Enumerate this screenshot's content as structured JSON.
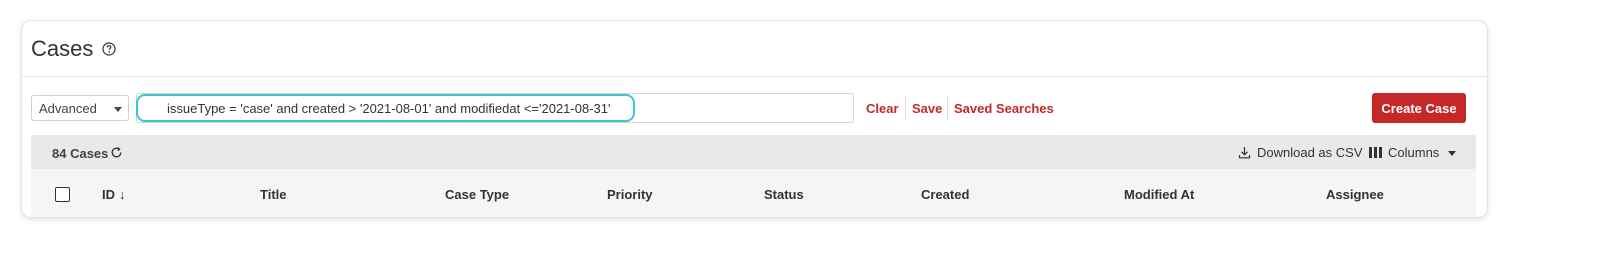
{
  "page": {
    "title": "Cases",
    "help_icon": "question-circle-icon"
  },
  "toolbar": {
    "mode": "Advanced",
    "query": "issueType = 'case' and created > '2021-08-01' and modifiedat <='2021-08-31'",
    "clear_label": "Clear",
    "save_label": "Save",
    "saved_searches_label": "Saved Searches",
    "create_label": "Create Case",
    "accent_color": "#c62828",
    "highlight_color": "#3fc6d6"
  },
  "results": {
    "count_label": "84 Cases",
    "refresh_icon": "refresh-icon",
    "download_label": "Download as CSV",
    "download_icon": "download-icon",
    "columns_label": "Columns",
    "columns_icon": "columns-icon"
  },
  "table": {
    "columns": [
      "ID",
      "Title",
      "Case Type",
      "Priority",
      "Status",
      "Created",
      "Modified At",
      "Assignee"
    ],
    "sort_arrow": "↓"
  }
}
